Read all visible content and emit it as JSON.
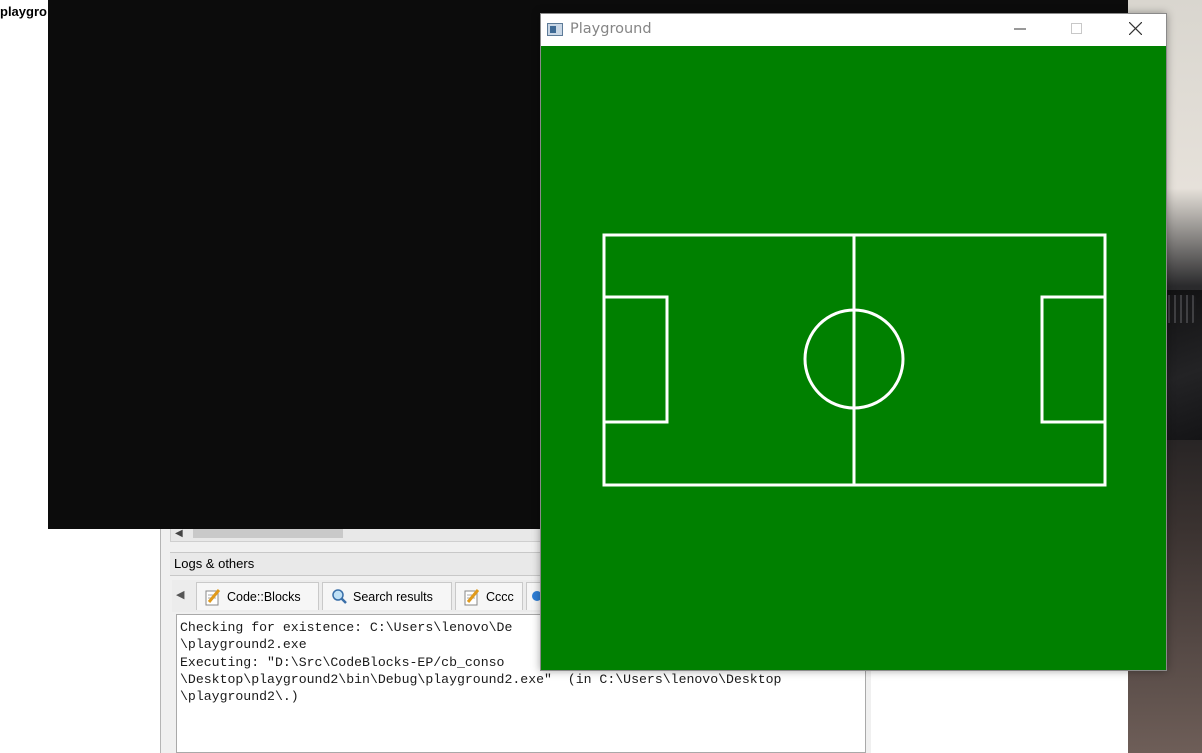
{
  "console_window": {
    "title_fragment": "playgro"
  },
  "ide": {
    "logs_panel_title": "Logs & others",
    "tabs": [
      {
        "label": "Code::Blocks",
        "icon": "pencil-note-icon"
      },
      {
        "label": "Search results",
        "icon": "magnifier-icon"
      },
      {
        "label": "Cccc",
        "icon": "pencil-note-icon"
      }
    ],
    "log_lines": [
      "Checking for existence: C:\\Users\\lenovo\\De",
      "\\playground2.exe",
      "Executing: \"D:\\Src\\CodeBlocks-EP/cb_conso",
      "\\Desktop\\playground2\\bin\\Debug\\playground2.exe\"  (in C:\\Users\\lenovo\\Desktop",
      "\\playground2\\.)"
    ]
  },
  "playground_window": {
    "title": "Playground",
    "minimize_icon": "minimize-icon",
    "maximize_icon": "maximize-icon",
    "close_icon": "close-icon",
    "colors": {
      "pitch": "#008000",
      "lines": "#ffffff"
    }
  }
}
